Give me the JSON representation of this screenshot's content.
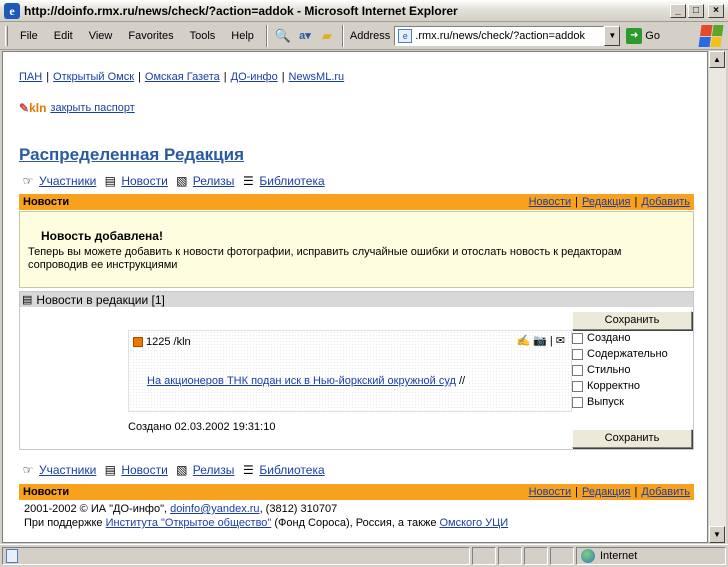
{
  "window": {
    "title": "http://doinfo.rmx.ru/news/check/?action=addok - Microsoft Internet Explorer",
    "controls": {
      "minimize": "_",
      "maximize": "□",
      "close": "×"
    }
  },
  "menu": {
    "items": [
      "File",
      "Edit",
      "View",
      "Favorites",
      "Tools",
      "Help"
    ],
    "address_label": "Address",
    "address_value": ".rmx.ru/news/check/?action=addok",
    "go_label": "Go"
  },
  "page": {
    "top_links": [
      "ПАН",
      "Открытый Омск",
      "Омская Газета",
      "ДО-инфо",
      "NewsML.ru"
    ],
    "kln_logo": "kln",
    "close_passport": "закрыть паспорт",
    "main_title": "Распределенная Редакция",
    "nav": [
      "Участники",
      "Новости",
      "Релизы",
      "Библиотека"
    ],
    "bar": {
      "label": "Новости",
      "links": [
        "Новости",
        "Редакция",
        "Добавить"
      ]
    },
    "notice": {
      "title": "Новость добавлена!",
      "body": "Теперь вы можете добавить к новости фотографии, исправить случайные ошибки и отослать новость к редакторам сопроводив ее инструкциями"
    },
    "section_title": "Новости в редакции [1]",
    "item": {
      "id": "1225 /kln",
      "link": "На акционеров ТНК подан иск в Нью-йоркский окружной суд",
      "link_suffix": " //",
      "created": "Создано 02.03.2002 19:31:10"
    },
    "save_label": "Сохранить",
    "checkboxes": [
      "Создано",
      "Содержательно",
      "Стильно",
      "Корректно",
      "Выпуск"
    ],
    "footer": {
      "line1_prefix": "2001-2002 © ИА \"ДО-инфо\", ",
      "email": "doinfo@yandex.ru",
      "line1_suffix": ", (3812) 310707",
      "line2_prefix": "При поддержке ",
      "institute": "Института \"Открытое общество\"",
      "line2_middle": " (Фонд Сороса), Россия, а также ",
      "omsk_uci": "Омского УЦИ"
    }
  },
  "status": {
    "zone": "Internet"
  },
  "colors": {
    "orange_bar": "#f7a11e",
    "notice_bg": "#fffde0",
    "link": "#1a3ea8",
    "title": "#2a5aa0"
  }
}
